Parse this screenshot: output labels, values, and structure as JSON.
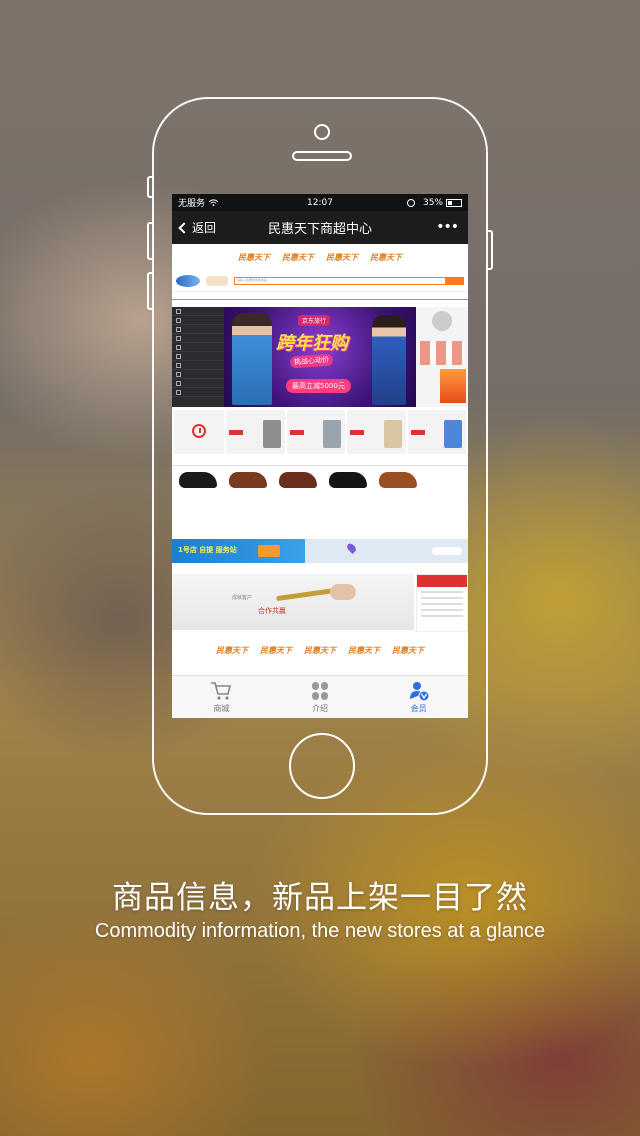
{
  "status_bar": {
    "carrier": "无服务",
    "time": "12:07",
    "battery_percent": "35%"
  },
  "nav": {
    "back_label": "返回",
    "title": "民惠天下商超中心",
    "more_icon": "more-dots-icon"
  },
  "web": {
    "brand_logo_text": "民惠天下",
    "search_placeholder": "请输入您要搜索的商品",
    "banner": {
      "tag": "京东旅行",
      "headline": "跨年狂购",
      "sub": "挑战心动价",
      "price": "最高立减5000元"
    },
    "map_banner_title": "1号店 自提 服务站",
    "join_banner": {
      "text1": "成就客户",
      "text2": "合作共赢"
    }
  },
  "tabbar": {
    "items": [
      {
        "label": "商城",
        "icon": "cart-icon"
      },
      {
        "label": "介绍",
        "icon": "clover-icon"
      },
      {
        "label": "会员",
        "icon": "member-icon"
      }
    ]
  },
  "captions": {
    "cn": "商品信息，新品上架一目了然",
    "en": "Commodity information, the new stores at a glance"
  },
  "colors": {
    "accent_orange": "#ff7a1a",
    "tab_active_blue": "#2f6fe0",
    "navbar_dark": "#1c1c1e"
  }
}
